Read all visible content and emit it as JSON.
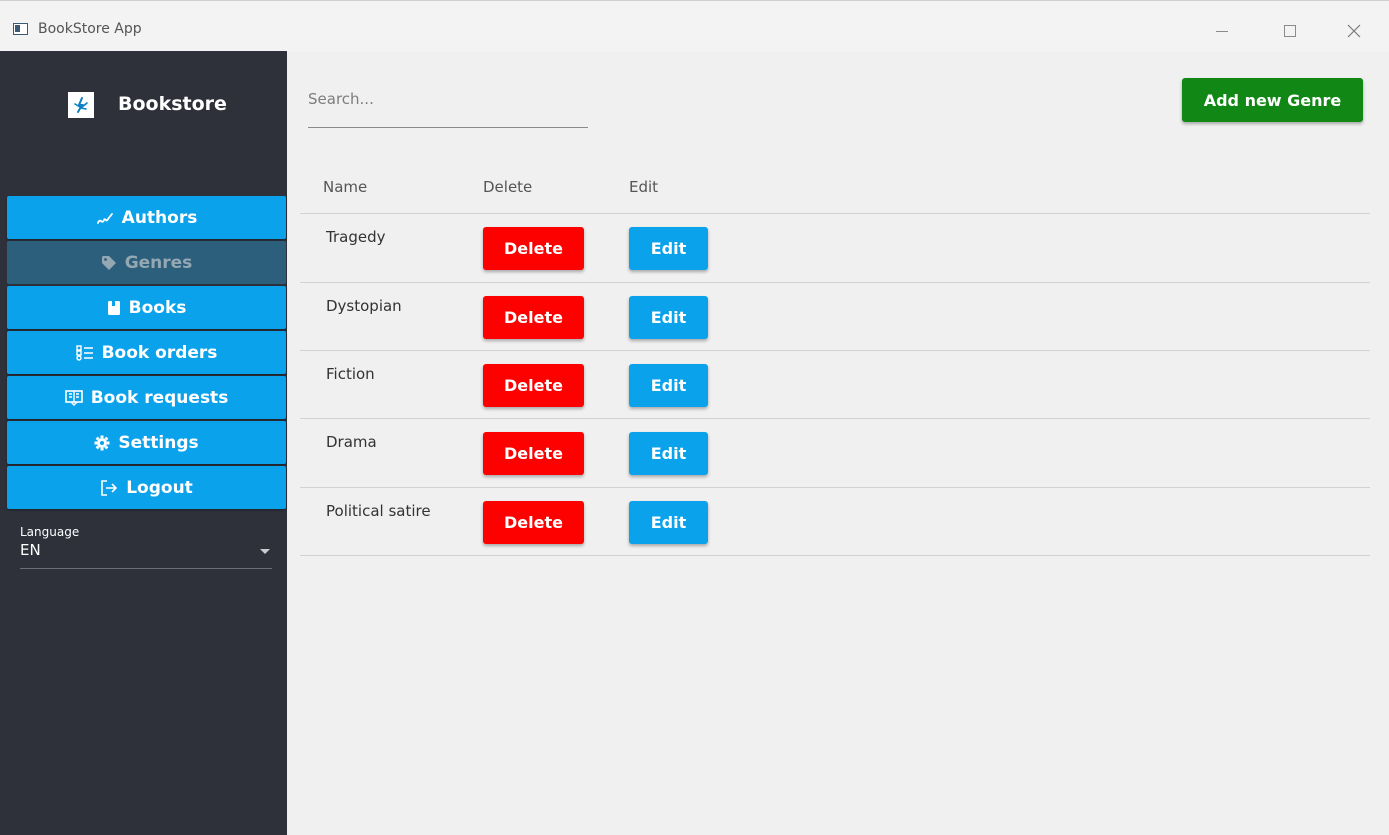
{
  "window": {
    "title": "BookStore App",
    "icon": "app-window-icon",
    "controls": [
      "minimize",
      "maximize",
      "close"
    ]
  },
  "sidebar": {
    "brand": "Bookstore",
    "logo_icon": "bookstore-logo-icon",
    "items": [
      {
        "label": "Authors",
        "icon": "signature-icon",
        "active": false
      },
      {
        "label": "Genres",
        "icon": "tag-icon",
        "active": true
      },
      {
        "label": "Books",
        "icon": "book-icon",
        "active": false
      },
      {
        "label": "Book orders",
        "icon": "checklist-icon",
        "active": false
      },
      {
        "label": "Book requests",
        "icon": "request-book-icon",
        "active": false
      },
      {
        "label": "Settings",
        "icon": "gear-icon",
        "active": false
      },
      {
        "label": "Logout",
        "icon": "logout-icon",
        "active": false
      }
    ],
    "language": {
      "label": "Language",
      "value": "EN"
    }
  },
  "main": {
    "search": {
      "placeholder": "Search..."
    },
    "add_button": "Add new Genre",
    "table": {
      "headers": [
        "Name",
        "Delete",
        "Edit"
      ],
      "rows": [
        {
          "name": " Tragedy",
          "delete": "Delete",
          "edit": "Edit"
        },
        {
          "name": "Dystopian",
          "delete": "Delete",
          "edit": "Edit"
        },
        {
          "name": "Fiction",
          "delete": "Delete",
          "edit": "Edit"
        },
        {
          "name": "Drama",
          "delete": "Delete",
          "edit": "Edit"
        },
        {
          "name": "Political satire",
          "delete": "Delete",
          "edit": "Edit"
        }
      ]
    }
  },
  "colors": {
    "sidebar_bg": "#2e313a",
    "nav_button": "#0ba2ec",
    "nav_active": "#2c5f7c",
    "add_button": "#118715",
    "delete_button": "#fd0000",
    "edit_button": "#0ba2ec"
  }
}
